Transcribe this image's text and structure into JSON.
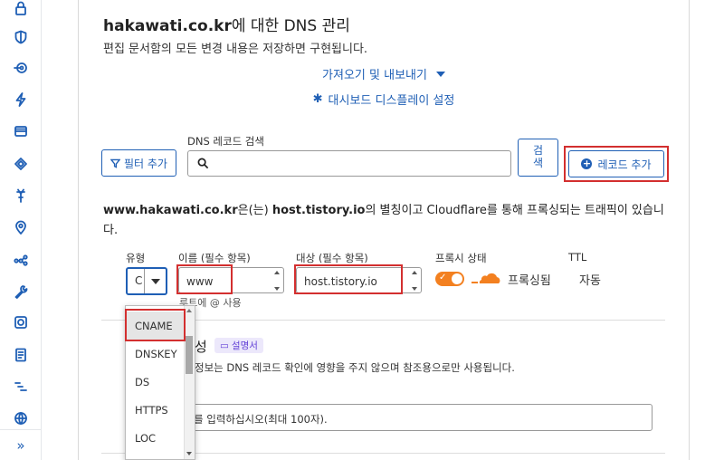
{
  "sidebar": {
    "icons": [
      "lock-icon",
      "shield-icon",
      "network-icon",
      "lightning-icon",
      "server-icon",
      "diamond-icon",
      "antenna-icon",
      "location-pin-icon",
      "share-nodes-icon",
      "wrench-icon",
      "square-target-icon",
      "document-icon",
      "stairs-icon",
      "globe-icon"
    ],
    "expand_label": "»"
  },
  "header": {
    "domain": "hakawati.co.kr",
    "title_suffix": "에 대한 DNS 관리",
    "subtitle": "편집 문서함의 모든 변경 내용은 저장하면 구현됩니다."
  },
  "links": {
    "import_export": "가져오기 및 내보내기",
    "dashboard_settings": "대시보드 디스플레이 설정"
  },
  "toolbar": {
    "filter_label": "필터 추가",
    "search_label": "DNS 레코드 검색",
    "search_value": "",
    "search_button_line1": "검",
    "search_button_line2": "색",
    "add_record_label": "레코드 추가"
  },
  "info": {
    "domain": "www.hakawati.co.kr",
    "text1": "은(는) ",
    "target": "host.tistory.io",
    "text2": "의 별칭이고 Cloudflare를 통해 프록싱되는 트래픽이 있습니다."
  },
  "form": {
    "type_label": "유형",
    "name_label": "이름 (필수 항목)",
    "target_label": "대상 (필수 항목)",
    "proxy_label": "프록시 상태",
    "ttl_label": "TTL",
    "type_value": "C",
    "name_value": "www",
    "name_hint": "루트에 @ 사용",
    "target_value": "host.tistory.io",
    "proxy_value": "프록싱됨",
    "ttl_value": "자동",
    "proxy_enabled": true
  },
  "options": {
    "section_title_tail": "성",
    "doc_badge": "설명서",
    "description": "정보는 DNS 레코드 확인에 영향을 주지 않으며 참조용으로만 사용됩니다.",
    "comment_placeholder": "를 입력하십시오(최대 100자)."
  },
  "dropdown": {
    "options": [
      "CNAME",
      "DNSKEY",
      "DS",
      "HTTPS",
      "LOC"
    ],
    "selected": "CNAME"
  },
  "colors": {
    "accent": "#1f5fb5",
    "highlight_box": "#d32f2f",
    "proxy_orange": "#f38020",
    "badge_purple": "#6240d6"
  }
}
